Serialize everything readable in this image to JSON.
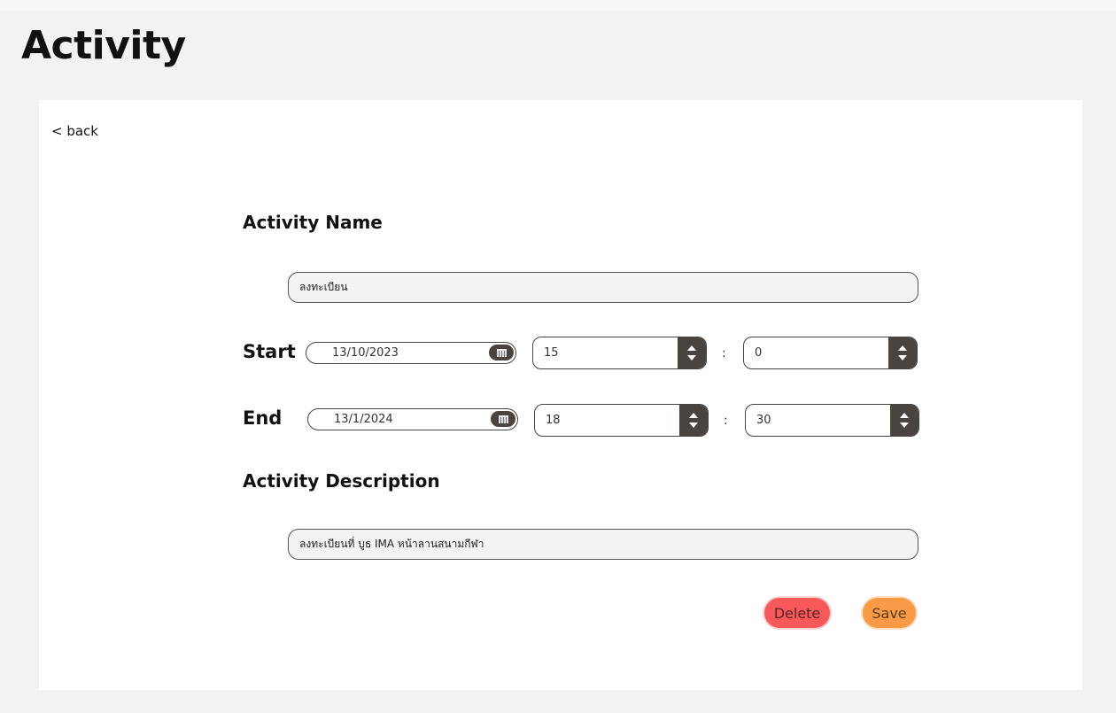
{
  "page": {
    "title": "Activity"
  },
  "nav": {
    "back_label": "< back"
  },
  "form": {
    "name_label": "Activity Name",
    "name_value": "ลงทะเบียน",
    "start": {
      "label": "Start",
      "date": "13/10/2023",
      "hour": "15",
      "separator": ":",
      "minute": "0"
    },
    "end": {
      "label": "End",
      "date": "13/1/2024",
      "hour": "18",
      "separator": ":",
      "minute": "30"
    },
    "description_label": "Activity Description",
    "description_value": "ลงทะเบียนที่ บูธ IMA หน้าลานสนามกีฬา"
  },
  "actions": {
    "delete_label": "Delete",
    "save_label": "Save"
  },
  "colors": {
    "background": "#f2f2f2",
    "card": "#ffffff",
    "field_fill": "#f4f2f2",
    "control_dark": "#4a4441",
    "delete": "#f7595a",
    "save": "#f99b46"
  },
  "icons": {
    "calendar": "calendar-icon",
    "spin_up": "chevron-up-icon",
    "spin_down": "chevron-down-icon"
  }
}
